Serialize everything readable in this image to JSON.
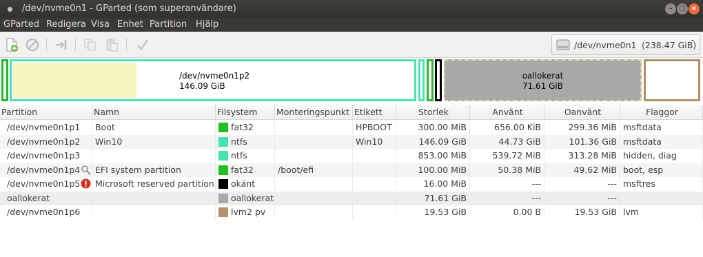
{
  "window": {
    "title": "/dev/nvme0n1 - GParted (som superanvändare)"
  },
  "menu": [
    "GParted",
    "Redigera",
    "Visa",
    "Enhet",
    "Partition",
    "Hjälp"
  ],
  "device": {
    "name": "/dev/nvme0n1",
    "size": "(238.47 GiB)"
  },
  "map": {
    "p2": {
      "name": "/dev/nvme0n1p2",
      "size": "146.09 GiB"
    },
    "unalloc": {
      "name": "oallokerat",
      "size": "71.61 GiB"
    }
  },
  "columns": [
    "Partition",
    "Namn",
    "Filsystem",
    "Monteringspunkt",
    "Etikett",
    "Storlek",
    "Använt",
    "Oanvänt",
    "Flaggor"
  ],
  "colors": {
    "fat32": "#21c021",
    "ntfs": "#42e5ac",
    "unknown": "#000000",
    "unallocated": "#a9a9a9",
    "lvm2": "#b39169"
  },
  "rows": [
    {
      "partition": "/dev/nvme0n1p1",
      "name": "Boot",
      "fs": "fat32",
      "fscolor": "#21c021",
      "mount": "",
      "label": "HPBOOT",
      "size": "300.00 MiB",
      "used": "656.00 KiB",
      "unused": "299.36 MiB",
      "flags": "msftdata",
      "icon": ""
    },
    {
      "partition": "/dev/nvme0n1p2",
      "name": "Win10",
      "fs": "ntfs",
      "fscolor": "#42e5ac",
      "mount": "",
      "label": "Win10",
      "size": "146.09 GiB",
      "used": "44.73 GiB",
      "unused": "101.36 GiB",
      "flags": "msftdata",
      "icon": ""
    },
    {
      "partition": "/dev/nvme0n1p3",
      "name": "",
      "fs": "ntfs",
      "fscolor": "#42e5ac",
      "mount": "",
      "label": "",
      "size": "853.00 MiB",
      "used": "539.72 MiB",
      "unused": "313.28 MiB",
      "flags": "hidden, diag",
      "icon": ""
    },
    {
      "partition": "/dev/nvme0n1p4",
      "name": "EFI system partition",
      "fs": "fat32",
      "fscolor": "#21c021",
      "mount": "/boot/efi",
      "label": "",
      "size": "100.00 MiB",
      "used": "50.38 MiB",
      "unused": "49.62 MiB",
      "flags": "boot, esp",
      "icon": "mounted-key-icon"
    },
    {
      "partition": "/dev/nvme0n1p5",
      "name": "Microsoft reserved partition",
      "fs": "okänt",
      "fscolor": "#000000",
      "mount": "",
      "label": "",
      "size": "16.00 MiB",
      "used": "---",
      "unused": "---",
      "flags": "msftres",
      "icon": "error-icon"
    },
    {
      "partition": "oallokerat",
      "name": "",
      "fs": "oallokerat",
      "fscolor": "#a9a9a9",
      "mount": "",
      "label": "",
      "size": "71.61 GiB",
      "used": "---",
      "unused": "---",
      "flags": "",
      "icon": ""
    },
    {
      "partition": "/dev/nvme0n1p6",
      "name": "",
      "fs": "lvm2 pv",
      "fscolor": "#b39169",
      "mount": "",
      "label": "",
      "size": "19.53 GiB",
      "used": "0.00 B",
      "unused": "19.53 GiB",
      "flags": "lvm",
      "icon": ""
    }
  ]
}
